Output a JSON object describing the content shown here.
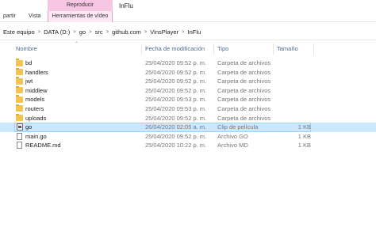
{
  "ribbon": {
    "context_header": "Reproducir",
    "window_title": "InFlu",
    "tabs": [
      "partir",
      "Vista",
      "Herramientas de vídeo"
    ]
  },
  "breadcrumb": [
    "Este equipo",
    "DATA (D:)",
    "go",
    "src",
    "github.com",
    "VinsPlayer",
    "InFlu"
  ],
  "columns": {
    "name": "Nombre",
    "date": "Fecha de modificación",
    "type": "Tipo",
    "size": "Tamaño"
  },
  "files": [
    {
      "name": "bd",
      "date": "25/04/2020 09:52 p. m.",
      "type": "Carpeta de archivos",
      "size": "",
      "icon": "folder-icon"
    },
    {
      "name": "handlers",
      "date": "25/04/2020 09:52 p. m.",
      "type": "Carpeta de archivos",
      "size": "",
      "icon": "folder-icon"
    },
    {
      "name": "jwt",
      "date": "25/04/2020 09:52 p. m.",
      "type": "Carpeta de archivos",
      "size": "",
      "icon": "folder-icon"
    },
    {
      "name": "middlew",
      "date": "25/04/2020 09:52 p. m.",
      "type": "Carpeta de archivos",
      "size": "",
      "icon": "folder-icon"
    },
    {
      "name": "models",
      "date": "25/04/2020 09:53 p. m.",
      "type": "Carpeta de archivos",
      "size": "",
      "icon": "folder-icon"
    },
    {
      "name": "routers",
      "date": "25/04/2020 09:53 p. m.",
      "type": "Carpeta de archivos",
      "size": "",
      "icon": "folder-icon"
    },
    {
      "name": "uploads",
      "date": "25/04/2020 09:52 p. m.",
      "type": "Carpeta de archivos",
      "size": "",
      "icon": "folder-icon"
    },
    {
      "name": "go",
      "date": "26/04/2020 02:05 a. m.",
      "type": "Clip de película",
      "size": "1 KB",
      "icon": "video-file-icon",
      "selected": true
    },
    {
      "name": "main.go",
      "date": "25/04/2020 09:52 p. m.",
      "type": "Archivo GO",
      "size": "1 KB",
      "icon": "file-icon"
    },
    {
      "name": "README.md",
      "date": "25/04/2020 10:22 p. m.",
      "type": "Archivo MD",
      "size": "1 KB",
      "icon": "file-icon"
    }
  ]
}
